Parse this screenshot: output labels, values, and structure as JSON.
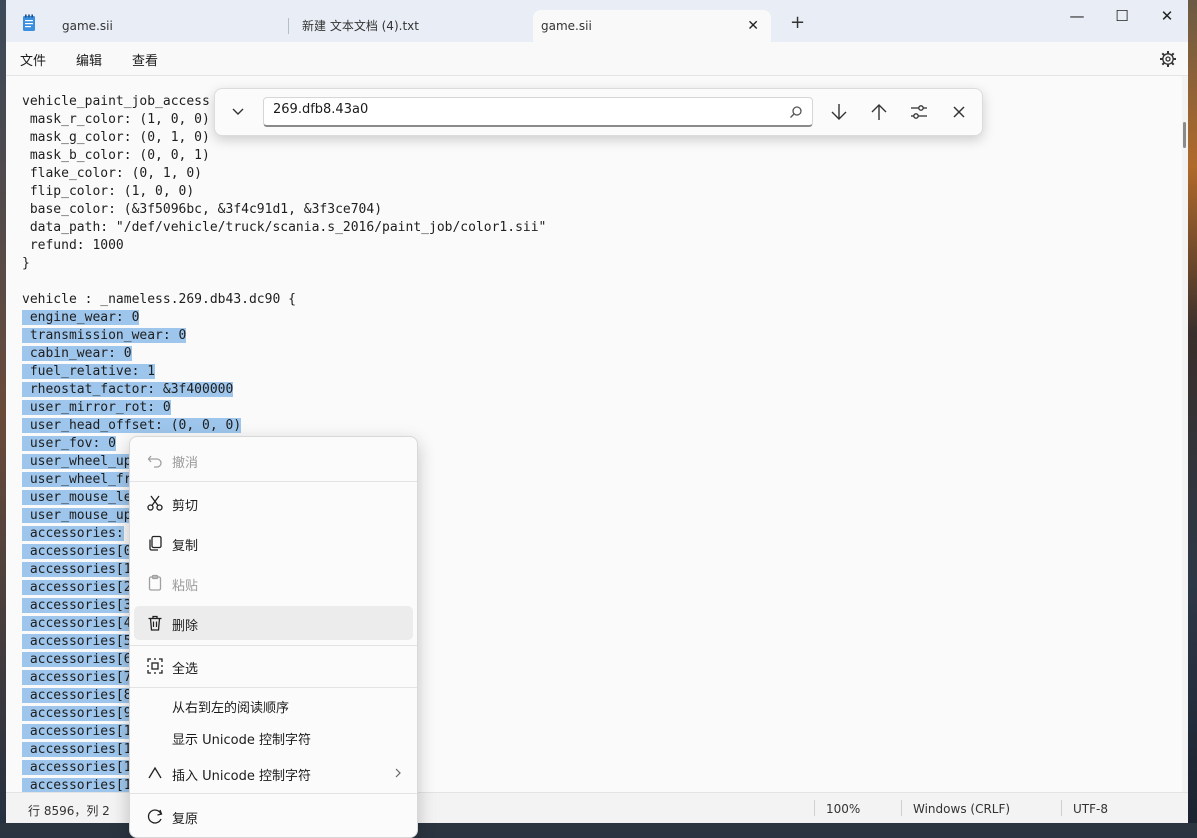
{
  "tabs": [
    {
      "label": "game.sii"
    },
    {
      "label": "新建 文本文档 (4).txt"
    },
    {
      "label": "game.sii"
    }
  ],
  "tab_close": "✕",
  "new_tab": "+",
  "window_controls": {
    "minimize": "—",
    "maximize": "☐",
    "close": "✕"
  },
  "menu": {
    "file": "文件",
    "edit": "编辑",
    "view": "查看"
  },
  "find": {
    "value": "269.dfb8.43a0"
  },
  "editor": {
    "lines": [
      "vehicle_paint_job_access",
      " mask_r_color: (1, 0, 0)",
      " mask_g_color: (0, 1, 0)",
      " mask_b_color: (0, 0, 1)",
      " flake_color: (0, 1, 0)",
      " flip_color: (1, 0, 0)",
      " base_color: (&3f5096bc, &3f4c91d1, &3f3ce704)",
      " data_path: \"/def/vehicle/truck/scania.s_2016/paint_job/color1.sii\"",
      " refund: 1000",
      "}",
      "",
      "vehicle : _nameless.269.db43.dc90 {"
    ],
    "selected_lines": [
      " engine_wear: 0",
      " transmission_wear: 0",
      " cabin_wear: 0",
      " fuel_relative: 1",
      " rheostat_factor: &3f400000",
      " user_mirror_rot: 0",
      " user_head_offset: (0, 0, 0)",
      " user_fov: 0",
      " user_wheel_up",
      " user_wheel_fr",
      " user_mouse_le",
      " user_mouse_up",
      " accessories:",
      " accessories[0",
      " accessories[1",
      " accessories[2",
      " accessories[3",
      " accessories[4",
      " accessories[5",
      " accessories[6",
      " accessories[7",
      " accessories[8",
      " accessories[9",
      " accessories[1",
      " accessories[1",
      " accessories[1",
      " accessories[1"
    ]
  },
  "context_menu": {
    "undo": "撤消",
    "cut": "剪切",
    "copy": "复制",
    "paste": "粘贴",
    "delete": "删除",
    "select_all": "全选",
    "rtl": "从右到左的阅读顺序",
    "show_unicode": "显示 Unicode 控制字符",
    "insert_unicode": "插入 Unicode 控制字符",
    "restore": "复原"
  },
  "status": {
    "position": "行 8596，列 2",
    "zoom": "100%",
    "line_ending": "Windows (CRLF)",
    "encoding": "UTF-8"
  },
  "colors": {
    "selection": "#9ec6ec",
    "tabbar": "#e9eef6"
  }
}
